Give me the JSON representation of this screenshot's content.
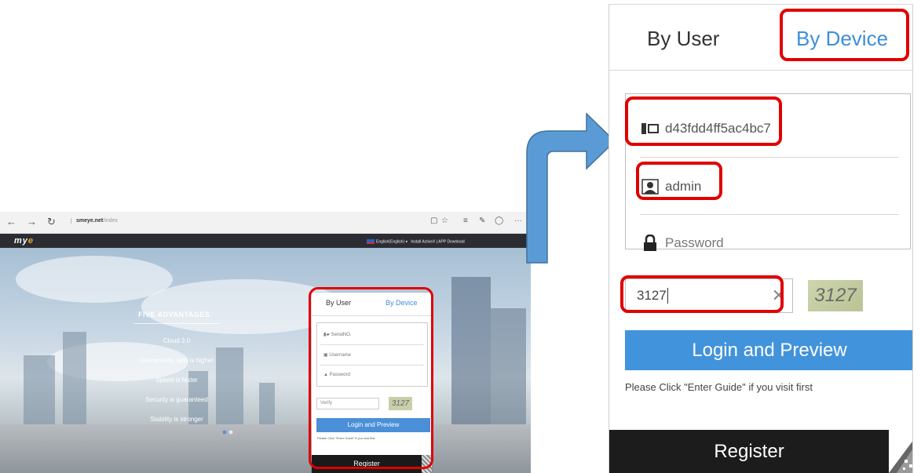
{
  "browser": {
    "url_host": "smeye.net",
    "url_path": "/index",
    "site_logo": "my",
    "site_logo_accent": "e",
    "language": "English(English)",
    "header_links": "Install ActiveX  |  APP Download",
    "advantages": {
      "title": "FIVE ADVANTAGES",
      "items": [
        "Cloud 3.0",
        "Connectivity ratio is higher",
        "Speed is faster",
        "Security is guaranteed",
        "Stability is stronger"
      ]
    },
    "small_panel": {
      "tab_user": "By User",
      "tab_device": "By Device",
      "serial_placeholder": "SerialNO.",
      "username_placeholder": "Username",
      "password_placeholder": "Password",
      "verify_placeholder": "Verify",
      "captcha": "3127",
      "login": "Login and Preview",
      "hint": "Please Click \"Enter Guide\" if you visit first",
      "register": "Register"
    }
  },
  "panel": {
    "tab_user": "By User",
    "tab_device": "By Device",
    "serial_value": "d43fdd4ff5ac4bc7",
    "username_value": "admin",
    "password_placeholder": "Password",
    "verify_value": "3127",
    "captcha": "3127",
    "login_button": "Login and Preview",
    "hint": "Please Click \"Enter Guide\" if you visit first",
    "register_button": "Register"
  },
  "colors": {
    "accent_blue": "#4193dc",
    "annotation_red": "#e00000",
    "dark": "#1c1c1c"
  }
}
